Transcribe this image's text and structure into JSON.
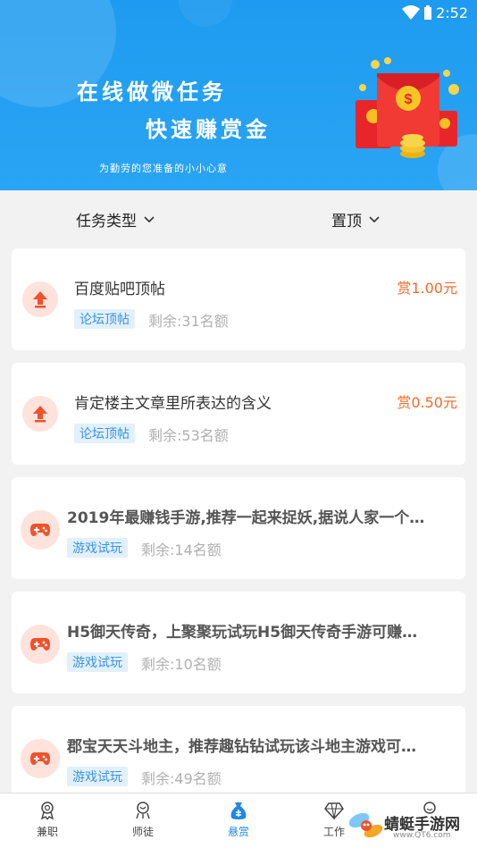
{
  "status_bar": {
    "time": "2:52"
  },
  "banner": {
    "line1": "在线做微任务",
    "line2": "快速赚赏金",
    "subtitle": "为勤劳的您准备的小小心意"
  },
  "filters": {
    "task_type": "任务类型",
    "top": "置顶"
  },
  "tasks": [
    {
      "title": "百度贴吧顶帖",
      "reward": "赏1.00元",
      "tag": "论坛顶帖",
      "remaining": "剩余:31名额",
      "icon": "arrow-up-icon"
    },
    {
      "title": "肯定楼主文章里所表达的含义",
      "reward": "赏0.50元",
      "tag": "论坛顶帖",
      "remaining": "剩余:53名额",
      "icon": "arrow-up-icon"
    },
    {
      "title": "2019年最赚钱手游,推荐一起来捉妖,据说人家一个…",
      "tag": "游戏试玩",
      "remaining": "剩余:14名额",
      "icon": "gamepad-icon"
    },
    {
      "title": "H5御天传奇，上聚聚玩试玩H5御天传奇手游可赚…",
      "tag": "游戏试玩",
      "remaining": "剩余:10名额",
      "icon": "gamepad-icon"
    },
    {
      "title": "郡宝天天斗地主，推荐趣钻钻试玩该斗地主游戏可…",
      "tag": "游戏试玩",
      "remaining": "剩余:49名额",
      "icon": "gamepad-icon"
    }
  ],
  "nav": {
    "items": [
      {
        "label": "兼职",
        "icon": "medal-icon"
      },
      {
        "label": "师徒",
        "icon": "mentor-icon"
      },
      {
        "label": "悬赏",
        "icon": "money-bag-icon",
        "active": true
      },
      {
        "label": "工作",
        "icon": "diamond-icon"
      },
      {
        "label": "",
        "icon": "profile-icon"
      }
    ]
  },
  "watermark": {
    "name": "蜻蜓手游网",
    "url": "www.QT6.com"
  },
  "colors": {
    "primary": "#1e9bf0",
    "reward": "#f26b2a",
    "tag_text": "#3a94e3",
    "tag_bg": "#e2f0fc",
    "icon_bg": "#fde3dc",
    "icon_fg": "#f0522c"
  }
}
